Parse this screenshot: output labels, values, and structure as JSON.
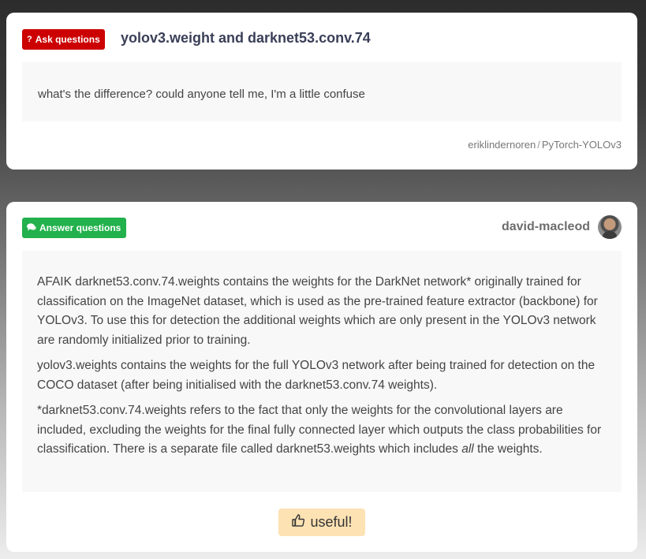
{
  "question": {
    "badge_label": "Ask questions",
    "badge_icon": "question-icon",
    "title": "yolov3.weight and darknet53.conv.74",
    "body": "what's the difference? could anyone tell me, I'm a little confuse",
    "repo_owner": "eriklindernoren",
    "repo_sep": "/",
    "repo_name": "PyTorch-YOLOv3"
  },
  "answer": {
    "badge_label": "Answer questions",
    "badge_icon": "comments-icon",
    "author": "david-macleod",
    "paragraphs": [
      "AFAIK darknet53.conv.74.weights contains the weights for the DarkNet network* originally trained for classification on the ImageNet dataset, which is used as the pre-trained feature extractor (backbone) for YOLOv3. To use this for detection the additional weights which are only present in the YOLOv3 network are randomly initialized prior to training.",
      "yolov3.weights contains the weights for the full YOLOv3 network after being trained for detection on the COCO dataset (after being initialised with the darknet53.conv.74 weights)."
    ],
    "p3_before": "*darknet53.conv.74.weights refers to the fact that only the weights for the convolutional layers are included, excluding the weights for the final fully connected layer which outputs the class probabilities for classification. There is a separate file called darknet53.weights which includes ",
    "p3_em": "all",
    "p3_after": " the weights.",
    "useful_label": "useful!"
  },
  "colors": {
    "ask_badge": "#cc0000",
    "answer_badge": "#22b14c",
    "useful_button": "#fde2b4",
    "title": "#3a3f58"
  }
}
